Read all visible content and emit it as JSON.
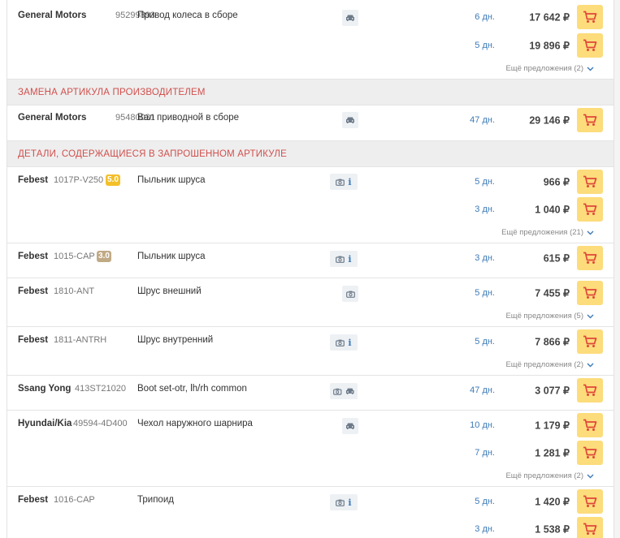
{
  "rows": [
    {
      "brand": "General Motors",
      "article": "95299893",
      "description": "Привод колеса в сборе",
      "offers": [
        {
          "days": "6 дн.",
          "price": "17 642 ₽"
        },
        {
          "days": "5 дн.",
          "price": "19 896 ₽"
        }
      ],
      "more": "Ещё предложения (2)"
    },
    {
      "brand": "General Motors",
      "article": "95480031",
      "description": "Вал приводной в сборе",
      "offers": [
        {
          "days": "47 дн.",
          "price": "29 146 ₽"
        }
      ]
    },
    {
      "brand": "Febest",
      "article": "1017P-V250",
      "rating": "5.0",
      "description": "Пыльник шруса",
      "offers": [
        {
          "days": "5 дн.",
          "price": "966 ₽"
        },
        {
          "days": "3 дн.",
          "price": "1 040 ₽"
        }
      ],
      "more": "Ещё предложения (21)"
    },
    {
      "brand": "Febest",
      "article": "1015-CAP",
      "rating": "3.0",
      "description": "Пыльник шруса",
      "offers": [
        {
          "days": "3 дн.",
          "price": "615 ₽"
        }
      ]
    },
    {
      "brand": "Febest",
      "article": "1810-ANT",
      "description": "Шрус внешний",
      "offers": [
        {
          "days": "5 дн.",
          "price": "7 455 ₽"
        }
      ],
      "more": "Ещё предложения (5)"
    },
    {
      "brand": "Febest",
      "article": "1811-ANTRH",
      "description": "Шрус внутренний",
      "offers": [
        {
          "days": "5 дн.",
          "price": "7 866 ₽"
        }
      ],
      "more": "Ещё предложения (2)"
    },
    {
      "brand": "Ssang Yong",
      "article": "413ST21020",
      "description": "Boot set-otr, lh/rh common",
      "offers": [
        {
          "days": "47 дн.",
          "price": "3 077 ₽"
        }
      ]
    },
    {
      "brand": "Hyundai/Kia",
      "article": "49594-4D400",
      "description": "Чехол наружного шарнира",
      "offers": [
        {
          "days": "10 дн.",
          "price": "1 179 ₽"
        },
        {
          "days": "7 дн.",
          "price": "1 281 ₽"
        }
      ],
      "more": "Ещё предложения (2)"
    },
    {
      "brand": "Febest",
      "article": "1016-CAP",
      "description": "Трипоид",
      "offers": [
        {
          "days": "5 дн.",
          "price": "1 420 ₽"
        },
        {
          "days": "3 дн.",
          "price": "1 538 ₽"
        }
      ]
    }
  ],
  "sections": {
    "replacement": "ЗАМЕНА АРТИКУЛА ПРОИЗВОДИТЕЛЕМ",
    "contained": "ДЕТАЛИ, СОДЕРЖАЩИЕСЯ В ЗАПРОШЕННОМ АРТИКУЛЕ"
  },
  "icons": {
    "car": "car-icon",
    "camera": "camera-icon",
    "info": "i",
    "cart": "cart-icon",
    "chevron": "chevron-down-icon"
  },
  "colors": {
    "section_text": "#d0504d",
    "link_blue": "#3d7ab7",
    "cart_bg": "#fcdc7b",
    "cart_icon": "#e0453a",
    "badge_yellow": "#f3c02a",
    "badge_tan": "#c0aa85"
  }
}
